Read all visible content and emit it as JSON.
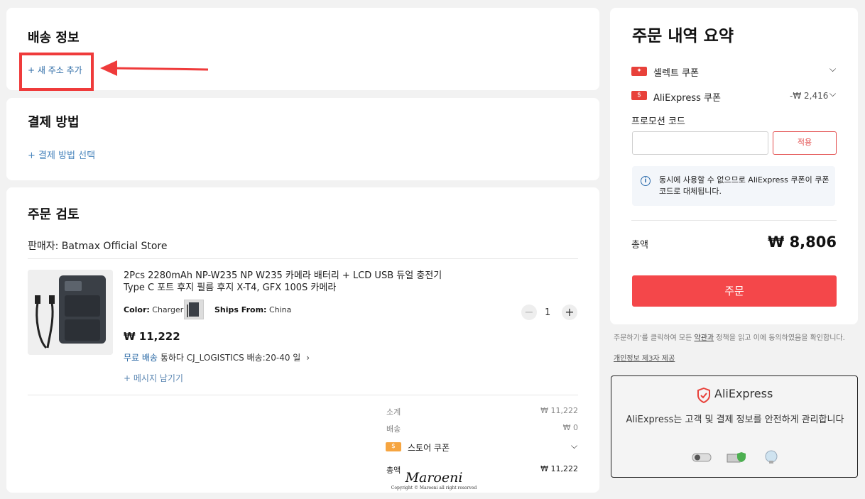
{
  "shipping": {
    "title": "배송 정보",
    "add_address": "+ 새 주소 추가"
  },
  "payment": {
    "title": "결제 방법",
    "select_method": "+ 결제 방법 선택"
  },
  "review": {
    "title": "주문 검토",
    "seller": "판매자: Batmax Official Store",
    "product": {
      "title": "2Pcs 2280mAh NP-W235 NP W235 카메라 배터리 + LCD USB 듀얼 충전기 Type C 포트 후지 필름 후지 X-T4, GFX 100S 카메라",
      "color_label": "Color:",
      "color_value": "Charger",
      "ships_label": "Ships From:",
      "ships_value": "China",
      "price": "₩ 11,222",
      "free_shipping": "무료 배송",
      "shipping_detail": "통하다 CJ_LOGISTICS 배송:20-40 일",
      "leave_message": "+ 메시지 남기기",
      "quantity": "1",
      "minus": "−",
      "plus": "+"
    },
    "subtotal_label": "소계",
    "subtotal_value": "₩ 11,222",
    "shipping_label": "배송",
    "shipping_value": "₩ 0",
    "store_coupon_label": "스토어 쿠폰",
    "total_label": "총액",
    "total_value": "₩ 11,222"
  },
  "summary": {
    "title": "주문 내역 요약",
    "select_coupon": "셀렉트 쿠폰",
    "ae_coupon": "AliExpress 쿠폰",
    "ae_coupon_value": "-₩ 2,416",
    "promo_label": "프로모션 코드",
    "promo_placeholder": "",
    "apply": "적용",
    "info": "동시에 사용할 수 없으므로 AliExpress 쿠폰이 쿠폰 코드로 대체됩니다.",
    "total_label": "총액",
    "total_value": "₩ 8,806",
    "order_button": "주문"
  },
  "terms": {
    "text_before": "주문하기'를 클릭하여 모든 ",
    "terms_link": "약관과",
    "text_after": " 정책을 읽고 이에 동의하였음을 확인합니다.",
    "privacy_link": "개인정보 제3자 제공"
  },
  "secure": {
    "brand": "AliExpress",
    "text": "AliExpress는 고객 및 결제 정보를 안전하게 관리합니다"
  },
  "watermark": {
    "name": "Maroeni",
    "copyright": "Copyright © Maroeni all right reserved"
  },
  "colors": {
    "accent_red": "#f4474a",
    "link_blue": "#2b6aa6",
    "annotation_red": "#ef3b3b"
  }
}
